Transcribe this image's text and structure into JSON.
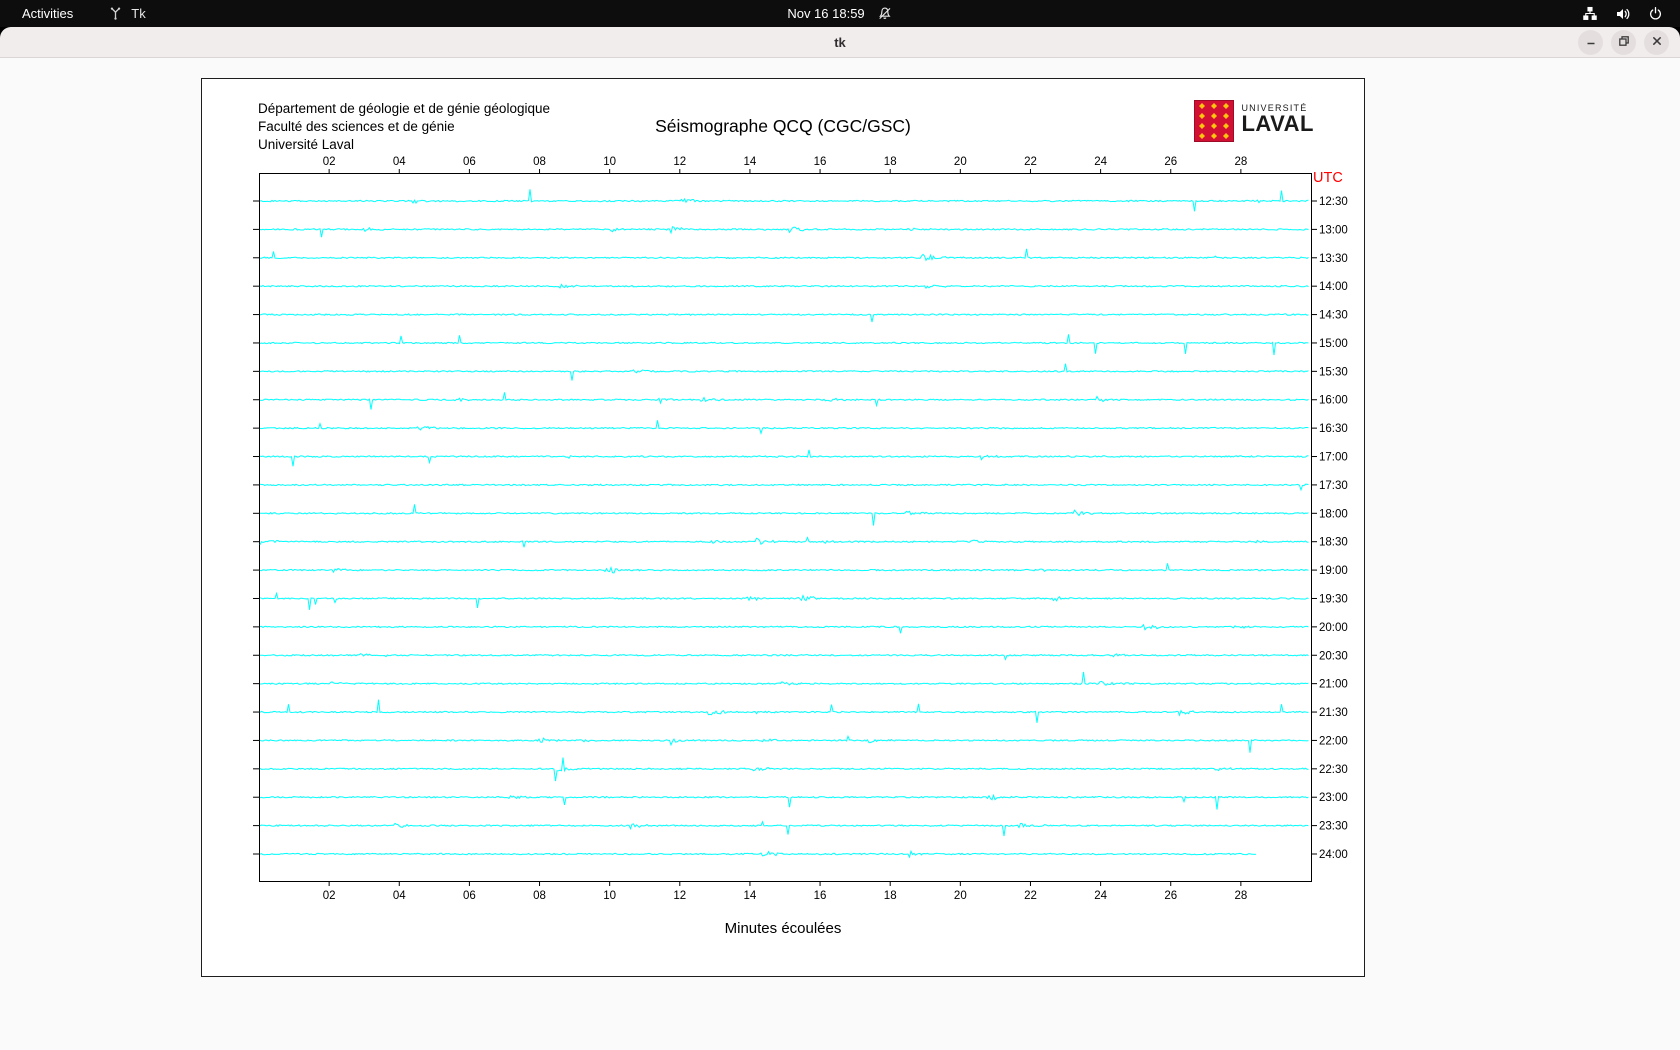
{
  "topbar": {
    "activities_label": "Activities",
    "app_name": "Tk",
    "clock": "Nov 16 18:59"
  },
  "window": {
    "title": "tk"
  },
  "seismograph": {
    "org_lines": [
      "Département de géologie et de génie géologique",
      "Faculté des sciences et de génie",
      "Université Laval"
    ],
    "logo": {
      "line1": "UNIVERSITÉ",
      "line2": "LAVAL"
    }
  },
  "icons": {
    "topbar": [
      "tk-app-icon",
      "notifications-muted-icon",
      "network-icon",
      "volume-icon",
      "power-icon"
    ],
    "window": [
      "minimize-icon",
      "restore-icon",
      "close-icon"
    ]
  },
  "chart_data": {
    "type": "line",
    "title": "Séismographe QCQ (CGC/GSC)",
    "xlabel": "Minutes écoulées",
    "right_axis_label": "UTC",
    "right_axis_label_color": "#ff0000",
    "trace_color": "#00ffff",
    "x_range_minutes": [
      0,
      30
    ],
    "x_ticks": [
      "02",
      "04",
      "06",
      "08",
      "10",
      "12",
      "14",
      "16",
      "18",
      "20",
      "22",
      "24",
      "26",
      "28"
    ],
    "trace_utc_labels": [
      "12:30",
      "13:00",
      "13:30",
      "14:00",
      "14:30",
      "15:00",
      "15:30",
      "16:00",
      "16:30",
      "17:00",
      "17:30",
      "18:00",
      "18:30",
      "19:00",
      "19:30",
      "20:00",
      "20:30",
      "21:00",
      "21:30",
      "22:00",
      "22:30",
      "23:00",
      "23:30",
      "24:00"
    ],
    "last_trace_end_minute": 28.5
  }
}
